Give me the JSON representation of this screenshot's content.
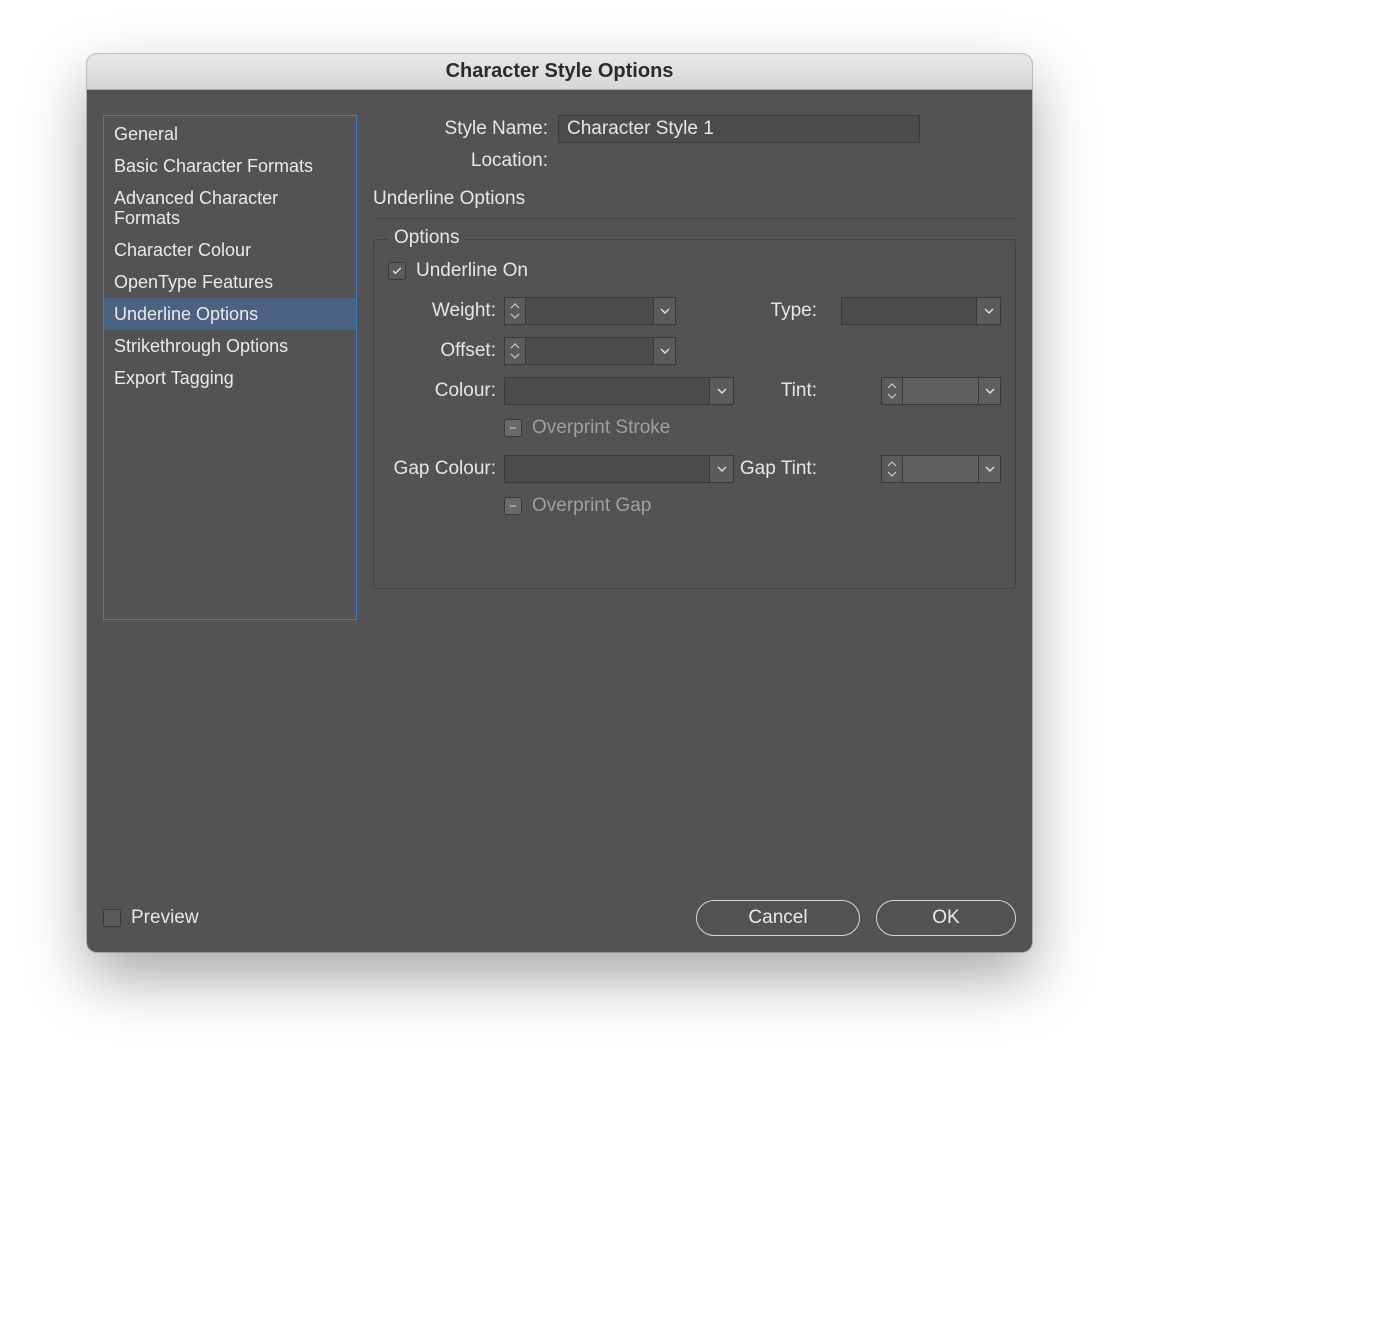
{
  "dialog": {
    "title": "Character Style Options",
    "style_name_label": "Style Name:",
    "style_name_value": "Character Style 1",
    "location_label": "Location:",
    "location_value": "",
    "section_title": "Underline Options"
  },
  "sidebar": {
    "items": [
      {
        "label": "General"
      },
      {
        "label": "Basic Character Formats"
      },
      {
        "label": "Advanced Character Formats"
      },
      {
        "label": "Character Colour"
      },
      {
        "label": "OpenType Features"
      },
      {
        "label": "Underline Options"
      },
      {
        "label": "Strikethrough Options"
      },
      {
        "label": "Export Tagging"
      }
    ],
    "selected_index": 5
  },
  "options": {
    "fieldset_legend": "Options",
    "underline_on_label": "Underline On",
    "underline_on_checked": true,
    "weight_label": "Weight:",
    "weight_value": "",
    "type_label": "Type:",
    "type_value": "",
    "offset_label": "Offset:",
    "offset_value": "",
    "colour_label": "Colour:",
    "colour_value": "",
    "tint_label": "Tint:",
    "tint_value": "",
    "overprint_stroke_label": "Overprint Stroke",
    "overprint_stroke_state": "mixed",
    "gap_colour_label": "Gap Colour:",
    "gap_colour_value": "",
    "gap_tint_label": "Gap Tint:",
    "gap_tint_value": "",
    "overprint_gap_label": "Overprint Gap",
    "overprint_gap_state": "mixed"
  },
  "footer": {
    "preview_label": "Preview",
    "preview_checked": false,
    "cancel_label": "Cancel",
    "ok_label": "OK"
  }
}
